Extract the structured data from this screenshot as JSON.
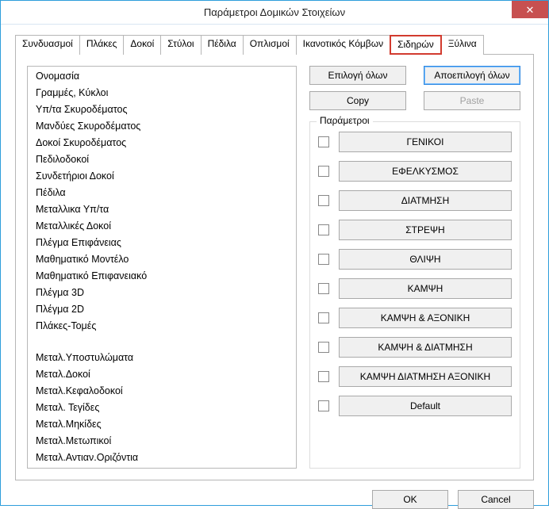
{
  "window": {
    "title": "Παράμετροι Δομικών Στοιχείων",
    "close_glyph": "✕"
  },
  "tabs": [
    {
      "label": "Συνδυασμοί"
    },
    {
      "label": "Πλάκες"
    },
    {
      "label": "Δοκοί"
    },
    {
      "label": "Στύλοι"
    },
    {
      "label": "Πέδιλα"
    },
    {
      "label": "Οπλισμοί"
    },
    {
      "label": "Ικανοτικός Κόμβων"
    },
    {
      "label": "Σιδηρών",
      "active": true
    },
    {
      "label": "Ξύλινα"
    }
  ],
  "list": [
    "Ονομασία",
    "Γραμμές, Κύκλοι",
    "Υπ/τα Σκυροδέματος",
    "Μανδύες Σκυροδέματος",
    "Δοκοί Σκυροδέματος",
    "Πεδιλοδοκοί",
    "Συνδετήριοι Δοκοί",
    "Πέδιλα",
    "Μεταλλικα Υπ/τα",
    "Μεταλλικές Δοκοί",
    "Πλέγμα Επιφάνειας",
    "Μαθηματικό Μοντέλο",
    "Μαθηματικό Επιφανειακό",
    "Πλέγμα 3D",
    "Πλέγμα 2D",
    "Πλάκες-Τομές",
    "",
    "Μεταλ.Υποστυλώματα",
    "Μεταλ.Δοκοί",
    "Μεταλ.Κεφαλοδοκοί",
    "Μεταλ. Τεγίδες",
    "Μεταλ.Μηκίδες",
    "Μεταλ.Μετωπικοί",
    "Μεταλ.Αντιαν.Οριζόντια"
  ],
  "buttons": {
    "select_all": "Επιλογή όλων",
    "deselect_all": "Αποεπιλογή όλων",
    "copy": "Copy",
    "paste": "Paste",
    "ok": "OK",
    "cancel": "Cancel"
  },
  "group_legend": "Παράμετροι",
  "params": [
    "ΓΕΝΙΚΟΙ",
    "ΕΦΕΛΚΥΣΜΟΣ",
    "ΔΙΑΤΜΗΣΗ",
    "ΣΤΡΕΨΗ",
    "ΘΛΙΨΗ",
    "ΚΑΜΨΗ",
    "ΚΑΜΨΗ & ΑΞΟΝΙΚΗ",
    "ΚΑΜΨΗ & ΔΙΑΤΜΗΣΗ",
    "ΚΑΜΨΗ  ΔΙΑΤΜΗΣΗ  ΑΞΟΝΙΚΗ",
    "Default"
  ]
}
